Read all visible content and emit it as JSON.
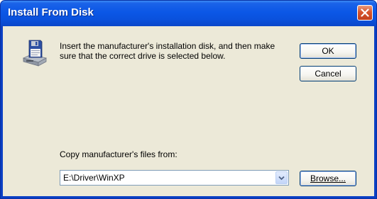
{
  "window": {
    "title": "Install From Disk"
  },
  "message": {
    "text": "Insert the manufacturer's installation disk, and then make sure that the correct drive is selected below."
  },
  "buttons": {
    "ok": "OK",
    "cancel": "Cancel",
    "browse": "Browse..."
  },
  "copy_from": {
    "label": "Copy manufacturer's files from:",
    "value": "E:\\Driver\\WinXP"
  },
  "icons": {
    "close": "close-icon",
    "disk": "install-disk-icon",
    "dropdown": "chevron-down-icon"
  },
  "colors": {
    "titlebar": "#0b57e6",
    "close_button": "#d7542e",
    "client_background": "#ece9d8",
    "button_border": "#003c74"
  }
}
